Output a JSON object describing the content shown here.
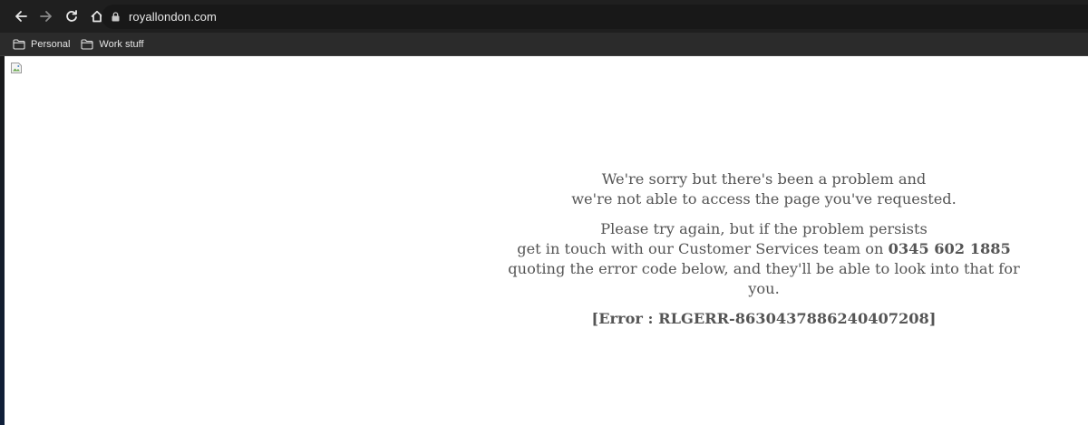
{
  "browser": {
    "url": "royallondon.com",
    "icons": {
      "back": "arrow-left-icon",
      "forward": "arrow-right-icon",
      "reload": "reload-icon",
      "home": "home-icon",
      "lock": "lock-icon"
    },
    "bookmarks": [
      {
        "label": "Personal",
        "icon": "folder-icon"
      },
      {
        "label": "Work stuff",
        "icon": "folder-icon"
      }
    ]
  },
  "page": {
    "intro_line1": "We're sorry but there's been a problem and",
    "intro_line2": "we're not able to access the page you've requested.",
    "retry_line1": "Please try again, but if the problem persists",
    "retry_line2_prefix": "get in touch with our Customer Services team on ",
    "phone": "0345 602 1885",
    "retry_line3": "quoting the error code below, and they'll be able to look into that for you.",
    "error_code": "[Error : RLGERR-8630437886240407208]"
  },
  "colors": {
    "toolbar_bg": "#1f1f1f",
    "bookmarks_bg": "#2b2b2b",
    "message_text": "#555555"
  }
}
